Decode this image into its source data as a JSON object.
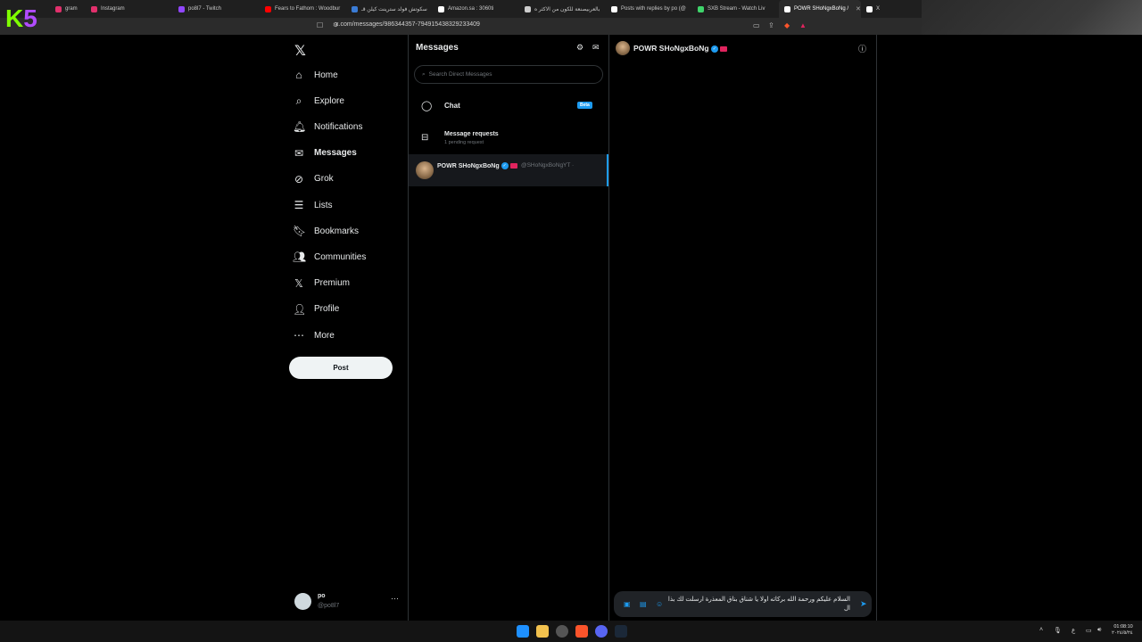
{
  "browser": {
    "tabs": [
      {
        "label": "gram",
        "color": "#e1306c"
      },
      {
        "label": "Instagram",
        "color": "#e1306c"
      },
      {
        "label": "po8l7 - Twitch",
        "color": "#9146ff"
      },
      {
        "label": "Fears to Fathom : Woodbur",
        "color": "#ff0000"
      },
      {
        "label": "سكوتش فولد سترينت كيلن قـ",
        "color": "#3a7bd5"
      },
      {
        "label": "Amazon.sa : 3060ti",
        "color": "#ffffff"
      },
      {
        "label": "بالعربيصنعة للكون من الاكثر ه",
        "color": "#cccccc"
      },
      {
        "label": "Posts with replies by po (@",
        "color": "#ffffff"
      },
      {
        "label": "SXB Stream - Watch Liv",
        "color": "#3fd46b"
      },
      {
        "label": "POWR SHoNgxBoNg /",
        "color": "#ffffff"
      },
      {
        "label": "X",
        "color": "#ffffff"
      }
    ],
    "active_tab_index": 9,
    "url": "x.com/messages/986344357-794915438329233409"
  },
  "overlay": {
    "logo_k": "K",
    "logo_5": "5"
  },
  "nav": {
    "logo": "𝕏",
    "items": [
      {
        "label": "Home",
        "icon": "home-icon",
        "glyph": "⌂"
      },
      {
        "label": "Explore",
        "icon": "search-icon",
        "glyph": "⌕"
      },
      {
        "label": "Notifications",
        "icon": "bell-icon",
        "glyph": "🔔︎"
      },
      {
        "label": "Messages",
        "icon": "mail-icon",
        "glyph": "✉"
      },
      {
        "label": "Grok",
        "icon": "grok-icon",
        "glyph": "⊘"
      },
      {
        "label": "Lists",
        "icon": "list-icon",
        "glyph": "☰"
      },
      {
        "label": "Bookmarks",
        "icon": "bookmark-icon",
        "glyph": "🔖︎"
      },
      {
        "label": "Communities",
        "icon": "communities-icon",
        "glyph": "👥︎"
      },
      {
        "label": "Premium",
        "icon": "x-premium-icon",
        "glyph": "𝕏"
      },
      {
        "label": "Profile",
        "icon": "person-icon",
        "glyph": "👤︎"
      },
      {
        "label": "More",
        "icon": "more-circle-icon",
        "glyph": "⋯"
      }
    ],
    "active_index": 3,
    "post_label": "Post",
    "account": {
      "name": "po",
      "handle": "@po8l7"
    }
  },
  "messages": {
    "title": "Messages",
    "search_placeholder": "Search Direct Messages",
    "chat_label": "Chat",
    "beta_label": "Beta",
    "requests_label": "Message requests",
    "requests_sub": "1 pending request",
    "conversation": {
      "name": "POWR SHoNgxBoNg",
      "handle": "@SHoNgxBoNgYT ·"
    }
  },
  "conversation": {
    "name": "POWR SHoNgxBoNg",
    "draft": "السلام عليكم ورحمة الله بركاته اولا يا شناق بناق المعذرة ارسلت لك بذا ال"
  },
  "taskbar": {
    "lang": "ع",
    "time": "01:08:10",
    "date": "٢٠٢٤/٥/٢٤"
  }
}
